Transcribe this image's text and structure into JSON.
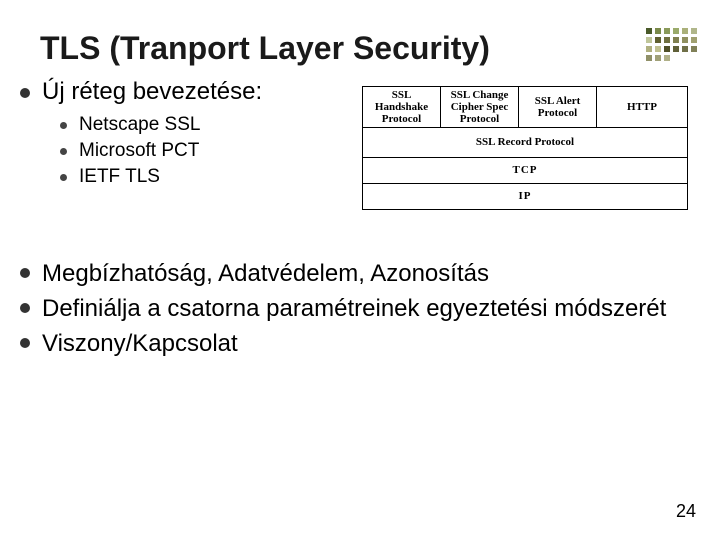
{
  "title": "TLS (Tranport Layer Security)",
  "bullets": {
    "b1": "Új réteg bevezetése:",
    "sub": {
      "s1": "Netscape SSL",
      "s2": "Microsoft PCT",
      "s3": "IETF TLS"
    },
    "b2": "Megbízhatóság, Adatvédelem, Azonosítás",
    "b3": "Definiálja a csatorna paramétreinek egyeztetési módszerét",
    "b4": "Viszony/Kapcsolat"
  },
  "diagram": {
    "top": {
      "c1": "SSL Handshake Protocol",
      "c2": "SSL Change Cipher Spec Protocol",
      "c3": "SSL Alert Protocol",
      "c4": "HTTP"
    },
    "r2": "SSL Record Protocol",
    "r3": "TCP",
    "r4": "IP"
  },
  "slide_number": "24",
  "deco_colors": [
    "#4a5a2a",
    "#7a8a4a",
    "#8a9a5a",
    "#9aaa6a",
    "#aab07a",
    "#b0b68a",
    "#c0c69a",
    "#606030",
    "#707040",
    "#808050",
    "#909060",
    "#a0a070",
    "#b0b080",
    "#c0c090",
    "#505028",
    "#606038",
    "#707048",
    "#808058",
    "#909068",
    "#a0a078",
    "#b0b088"
  ]
}
